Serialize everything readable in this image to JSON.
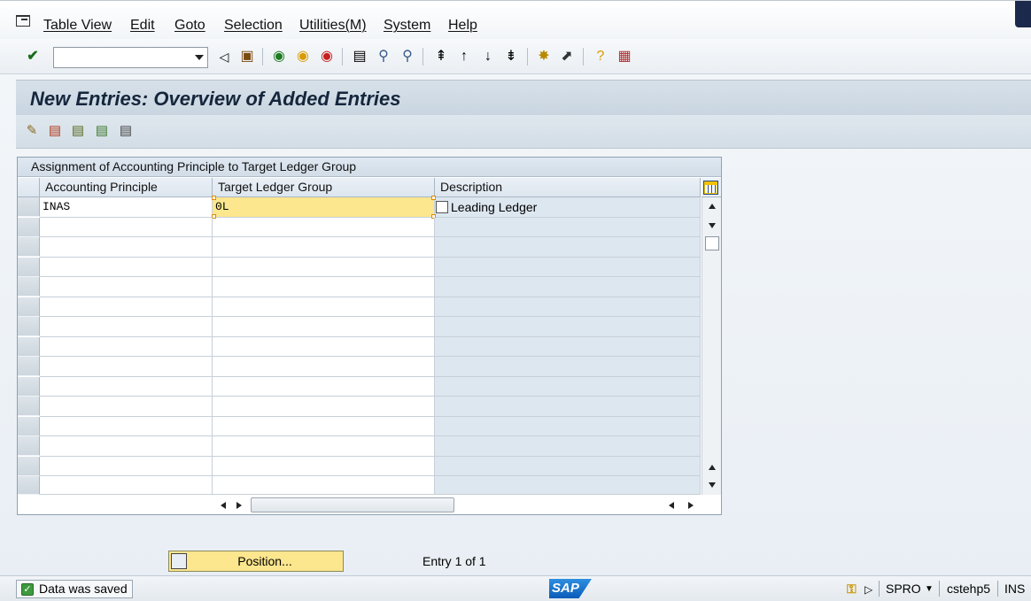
{
  "menu": [
    "Table View",
    "Edit",
    "Goto",
    "Selection",
    "Utilities(M)",
    "System",
    "Help"
  ],
  "toolbar": {
    "command_value": ""
  },
  "page": {
    "title": "New Entries: Overview of Added Entries"
  },
  "table": {
    "title": "Assignment of Accounting Principle to Target Ledger Group",
    "columns": [
      "Accounting Principle",
      "Target Ledger Group",
      "Description"
    ],
    "rows": [
      {
        "principle": "INAS",
        "ledger_group": "0L",
        "description": "Leading Ledger"
      }
    ]
  },
  "footer": {
    "position_label": "Position...",
    "entry_info": "Entry 1 of 1"
  },
  "status": {
    "message": "Data was saved",
    "transaction": "SPRO",
    "server": "cstehp5",
    "mode": "INS",
    "logo": "SAP"
  },
  "colors": {
    "focus_cell": "#fce68e",
    "readonly_cell": "#dde7f0",
    "title_text": "#15263c"
  }
}
